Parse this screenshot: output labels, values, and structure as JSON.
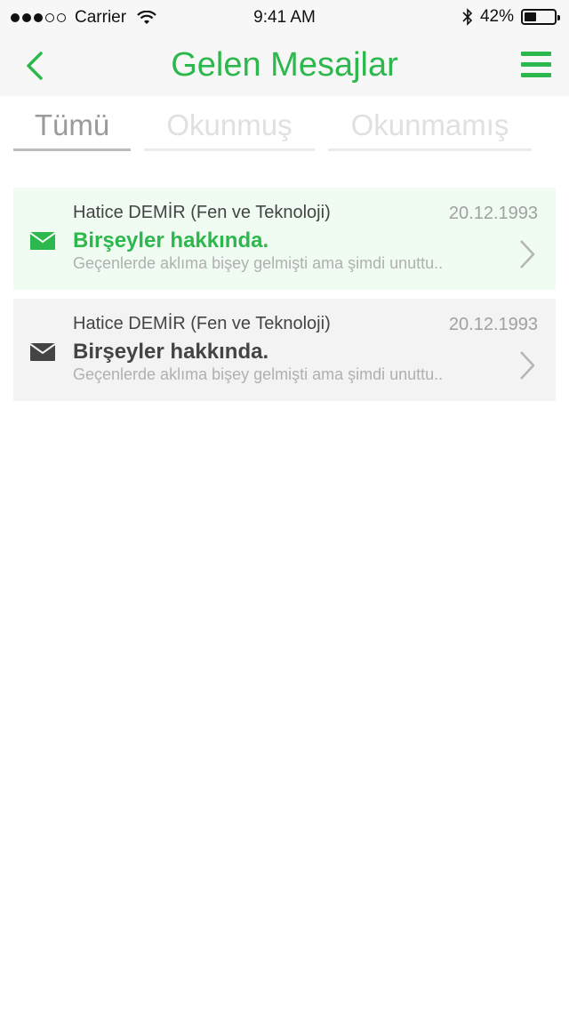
{
  "status_bar": {
    "carrier": "Carrier",
    "time": "9:41 AM",
    "battery_text": "42%",
    "battery_level": 0.42,
    "signal_bars_filled": 3,
    "signal_bars_total": 5
  },
  "nav": {
    "title": "Gelen Mesajlar",
    "back_icon": "chevron-left-icon",
    "menu_icon": "hamburger-menu-icon"
  },
  "tabs": [
    {
      "label": "Tümü",
      "active": true
    },
    {
      "label": "Okunmuş",
      "active": false
    },
    {
      "label": "Okunmamış",
      "active": false
    }
  ],
  "messages": [
    {
      "sender": "Hatice DEMİR (Fen ve Teknoloji)",
      "date": "20.12.1993",
      "subject": "Birşeyler hakkında.",
      "preview": "Geçenlerde aklıma bişey gelmişti ama şimdi unuttu..",
      "unread": true,
      "icon": "envelope-icon"
    },
    {
      "sender": "Hatice DEMİR (Fen ve Teknoloji)",
      "date": "20.12.1993",
      "subject": "Birşeyler hakkında.",
      "preview": "Geçenlerde aklıma bişey gelmişti ama şimdi unuttu..",
      "unread": false,
      "icon": "envelope-icon"
    }
  ],
  "colors": {
    "accent": "#2db84d",
    "unread_background": "#f0fcf2",
    "read_background": "#f3f3f3",
    "read_icon": "#444444"
  }
}
